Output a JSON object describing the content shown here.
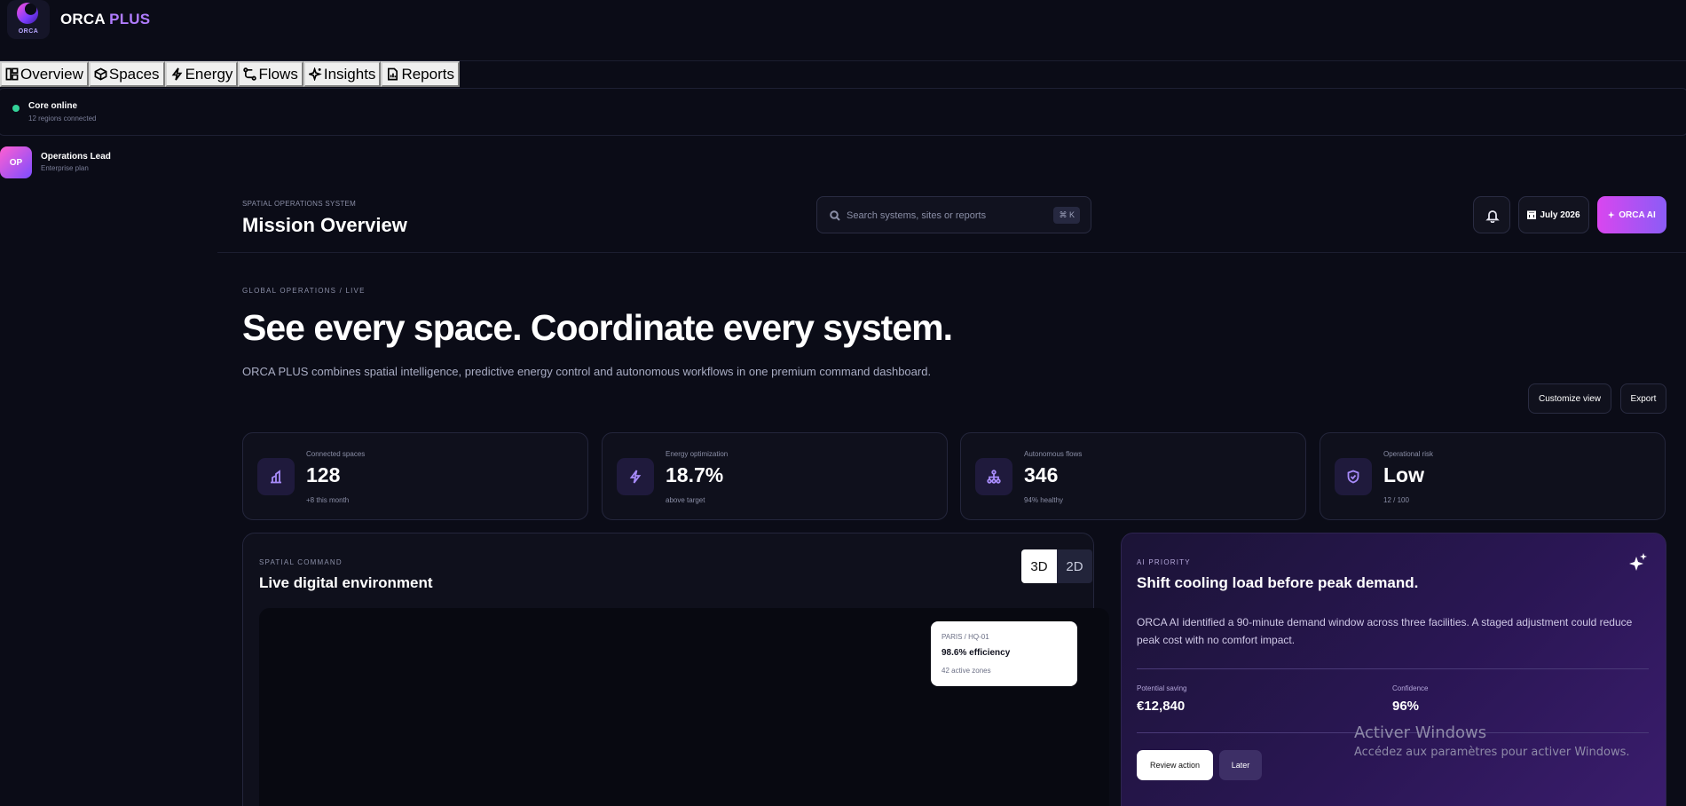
{
  "brand": {
    "logo_text": "ORCA",
    "name_part1": "ORCA",
    "name_part2": "PLUS"
  },
  "nav": [
    {
      "label": "Overview",
      "icon": "layout-icon"
    },
    {
      "label": "Spaces",
      "icon": "cube-icon"
    },
    {
      "label": "Energy",
      "icon": "bolt-icon"
    },
    {
      "label": "Flows",
      "icon": "flow-icon"
    },
    {
      "label": "Insights",
      "icon": "sparkles-icon"
    },
    {
      "label": "Reports",
      "icon": "report-icon"
    }
  ],
  "status": {
    "title": "Core online",
    "subtitle": "12 regions connected",
    "color": "#34d399"
  },
  "user": {
    "initials": "OP",
    "name": "Operations Lead",
    "plan": "Enterprise plan"
  },
  "header": {
    "eyebrow": "SPATIAL OPERATIONS SYSTEM",
    "title": "Mission Overview",
    "search_placeholder": "Search systems, sites or reports",
    "shortcut": "⌘ K",
    "date_label": "July 2026",
    "ai_button": "ORCA AI"
  },
  "hero": {
    "eyebrow": "GLOBAL OPERATIONS / LIVE",
    "title": "See every space. Coordinate every system.",
    "description": "ORCA PLUS combines spatial intelligence, predictive energy control and autonomous workflows in one premium command dashboard.",
    "customize_label": "Customize view",
    "export_label": "Export"
  },
  "stats": [
    {
      "label": "Connected spaces",
      "value": "128",
      "sub": "+8 this month",
      "icon": "building-chart-icon"
    },
    {
      "label": "Energy optimization",
      "value": "18.7%",
      "sub": "above target",
      "icon": "bolt-icon"
    },
    {
      "label": "Autonomous flows",
      "value": "346",
      "sub": "94% healthy",
      "icon": "network-icon"
    },
    {
      "label": "Operational risk",
      "value": "Low",
      "sub": "12 / 100",
      "icon": "shield-icon"
    }
  ],
  "spatial": {
    "eyebrow": "SPATIAL COMMAND",
    "title": "Live digital environment",
    "mode_3d": "3D",
    "mode_2d": "2D",
    "active_mode": "3D",
    "location_card": {
      "site": "PARIS / HQ-01",
      "efficiency": "98.6% efficiency",
      "zones": "42 active zones"
    }
  },
  "ai_priority": {
    "eyebrow": "AI PRIORITY",
    "title": "Shift cooling load before peak demand.",
    "description": "ORCA AI identified a 90-minute demand window across three facilities. A staged adjustment could reduce peak cost with no comfort impact.",
    "saving_label": "Potential saving",
    "saving_value": "€12,840",
    "confidence_label": "Confidence",
    "confidence_value": "96%",
    "review_label": "Review action",
    "later_label": "Later"
  },
  "watermark": {
    "title": "Activer Windows",
    "subtitle": "Accédez aux paramètres pour activer Windows."
  },
  "colors": {
    "accent": "#8b5cf6",
    "accent_pink": "#d946ef",
    "background": "#0b0c17"
  }
}
